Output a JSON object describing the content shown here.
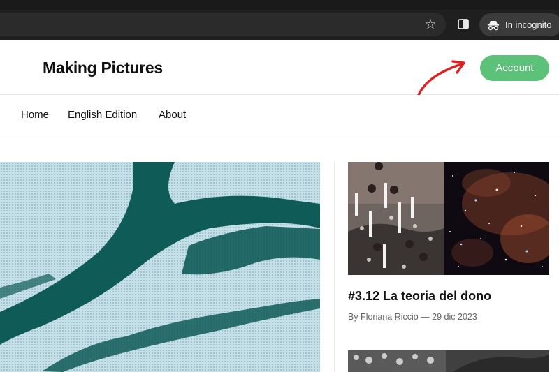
{
  "browser": {
    "incognito_label": "In incognito",
    "icons": [
      "star-icon",
      "side-panel-icon",
      "incognito-icon"
    ]
  },
  "header": {
    "site_title": "Making Pictures",
    "account_label": "Account",
    "accent_color": "#5cc27a",
    "annotation_color": "#e02020"
  },
  "nav": {
    "items": [
      {
        "label": "Home"
      },
      {
        "label": "English Edition"
      },
      {
        "label": "About"
      }
    ]
  },
  "post": {
    "title": "#3.12 La teoria del dono",
    "meta": "By Floriana Riccio — 29 dic 2023"
  }
}
